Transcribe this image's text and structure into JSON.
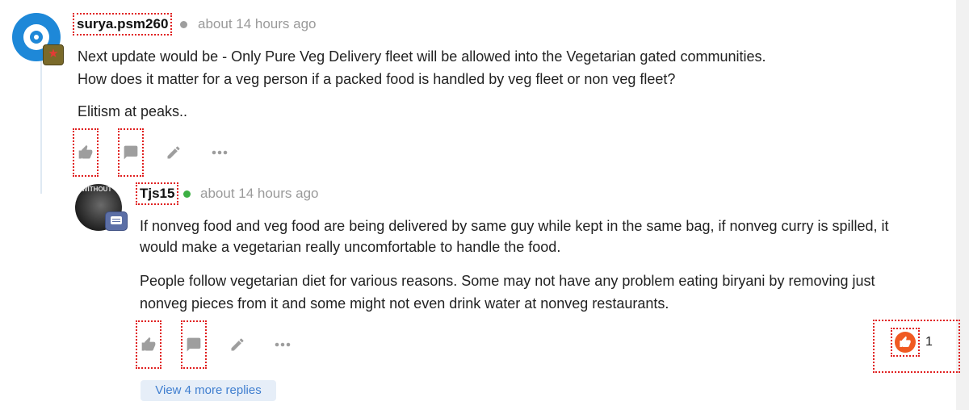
{
  "comment1": {
    "username": "surya.psm260",
    "timestamp": "about 14 hours ago",
    "status_color": "#9e9e9e",
    "lines": [
      "Next update would be - Only Pure Veg Delivery fleet will be allowed into the Vegetarian gated communities.",
      "How does it matter for a veg person if a packed food is handled by veg fleet or non veg fleet?"
    ],
    "paragraph2": "Elitism at peaks..",
    "actions": [
      "like-icon",
      "reply-icon",
      "edit-icon",
      "more-icon"
    ]
  },
  "comment2": {
    "username": "Tjs15",
    "timestamp": "about 14 hours ago",
    "status_color": "#3cb043",
    "avatar_text": "WITHOUT",
    "para1_lines": [
      "If nonveg food and veg food are being delivered by same guy while kept in the same bag, if nonveg curry is spilled, it",
      "would make a vegetarian really uncomfortable to handle the food."
    ],
    "para2_lines": [
      "People follow vegetarian diet for various reasons. Some may not have any problem eating biryani by removing just",
      "nonveg pieces from it and some might not even drink water at nonveg restaurants."
    ],
    "actions": [
      "like-icon",
      "reply-icon",
      "edit-icon",
      "more-icon"
    ],
    "reaction": {
      "icon": "thumbs-up-reaction-icon",
      "count": "1",
      "color": "#f05a22"
    }
  },
  "view_more_replies": "View 4 more replies",
  "colors": {
    "icon_gray": "#9e9e9e",
    "accent_blue": "#3f7ecf",
    "avatar_blue": "#1e88d8"
  }
}
